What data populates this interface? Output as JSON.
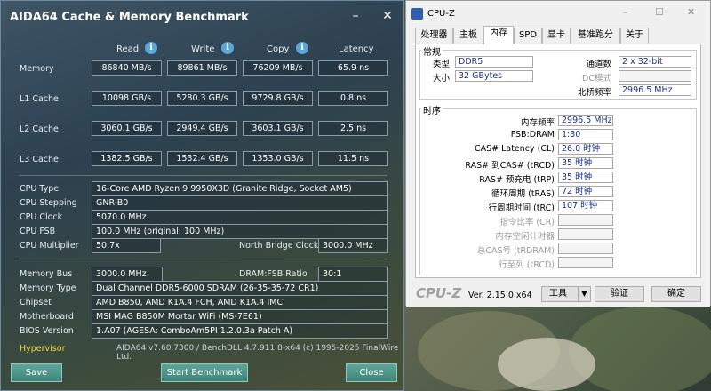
{
  "aida": {
    "title": "AIDA64 Cache & Memory Benchmark",
    "columns": {
      "read": "Read",
      "write": "Write",
      "copy": "Copy",
      "latency": "Latency"
    },
    "bench": [
      {
        "label": "Memory",
        "read": "86840 MB/s",
        "write": "89861 MB/s",
        "copy": "76209 MB/s",
        "latency": "65.9 ns"
      },
      {
        "label": "L1 Cache",
        "read": "10098 GB/s",
        "write": "5280.3 GB/s",
        "copy": "9729.8 GB/s",
        "latency": "0.8 ns"
      },
      {
        "label": "L2 Cache",
        "read": "3060.1 GB/s",
        "write": "2949.4 GB/s",
        "copy": "3603.1 GB/s",
        "latency": "2.5 ns"
      },
      {
        "label": "L3 Cache",
        "read": "1382.5 GB/s",
        "write": "1532.4 GB/s",
        "copy": "1353.0 GB/s",
        "latency": "11.5 ns"
      }
    ],
    "cpu": {
      "type_label": "CPU Type",
      "type": "16-Core AMD Ryzen 9 9950X3D  (Granite Ridge, Socket AM5)",
      "stepping_label": "CPU Stepping",
      "stepping": "GNR-B0",
      "clock_label": "CPU Clock",
      "clock": "5070.0 MHz",
      "fsb_label": "CPU FSB",
      "fsb": "100.0 MHz  (original: 100 MHz)",
      "mult_label": "CPU Multiplier",
      "mult": "50.7x",
      "nb_label": "North Bridge Clock",
      "nb": "3000.0 MHz"
    },
    "mem": {
      "bus_label": "Memory Bus",
      "bus": "3000.0 MHz",
      "ratio_label": "DRAM:FSB Ratio",
      "ratio": "30:1",
      "type_label": "Memory Type",
      "type": "Dual Channel DDR5-6000 SDRAM  (26-35-35-72 CR1)",
      "chipset_label": "Chipset",
      "chipset": "AMD B850, AMD K1A.4 FCH, AMD K1A.4 IMC",
      "mobo_label": "Motherboard",
      "mobo": "MSI MAG B850M Mortar WiFi (MS-7E61)",
      "bios_label": "BIOS Version",
      "bios": "1.A07  (AGESA: ComboAm5PI 1.2.0.3a Patch A)"
    },
    "hypervisor": "Hypervisor",
    "version": "AIDA64 v7.60.7300 / BenchDLL 4.7.911.8-x64  (c) 1995-2025 FinalWire Ltd.",
    "buttons": {
      "save": "Save",
      "start": "Start Benchmark",
      "close": "Close"
    }
  },
  "cpuz": {
    "title": "CPU-Z",
    "tabs": [
      "处理器",
      "主板",
      "内存",
      "SPD",
      "显卡",
      "基准跑分",
      "关于"
    ],
    "general": {
      "title": "常规",
      "type_label": "类型",
      "type": "DDR5",
      "size_label": "大小",
      "size": "32 GBytes",
      "channels_label": "通道数",
      "channels": "2 x 32-bit",
      "dc_label": "DC模式",
      "dc": "",
      "nb_label": "北桥频率",
      "nb": "2996.5 MHz"
    },
    "timings": {
      "title": "时序",
      "rows": [
        {
          "label": "内存频率",
          "value": "2996.5 MHz",
          "dim": false
        },
        {
          "label": "FSB:DRAM",
          "value": "1:30",
          "dim": false
        },
        {
          "label": "CAS# Latency (CL)",
          "value": "26.0 时钟",
          "dim": false
        },
        {
          "label": "RAS# 到CAS# (tRCD)",
          "value": "35 时钟",
          "dim": false
        },
        {
          "label": "RAS# 预充电 (tRP)",
          "value": "35 时钟",
          "dim": false
        },
        {
          "label": "循环周期 (tRAS)",
          "value": "72 时钟",
          "dim": false
        },
        {
          "label": "行周期时间 (tRC)",
          "value": "107 时钟",
          "dim": false
        },
        {
          "label": "指令比率 (CR)",
          "value": "",
          "dim": true
        },
        {
          "label": "内存空闲计时器",
          "value": "",
          "dim": true
        },
        {
          "label": "总CAS号 (tRDRAM)",
          "value": "",
          "dim": true
        },
        {
          "label": "行至列 (tRCD)",
          "value": "",
          "dim": true
        }
      ]
    },
    "footer": {
      "logo": "CPU-Z",
      "version": "Ver. 2.15.0.x64",
      "tools": "工具",
      "validate": "验证",
      "ok": "确定"
    }
  }
}
